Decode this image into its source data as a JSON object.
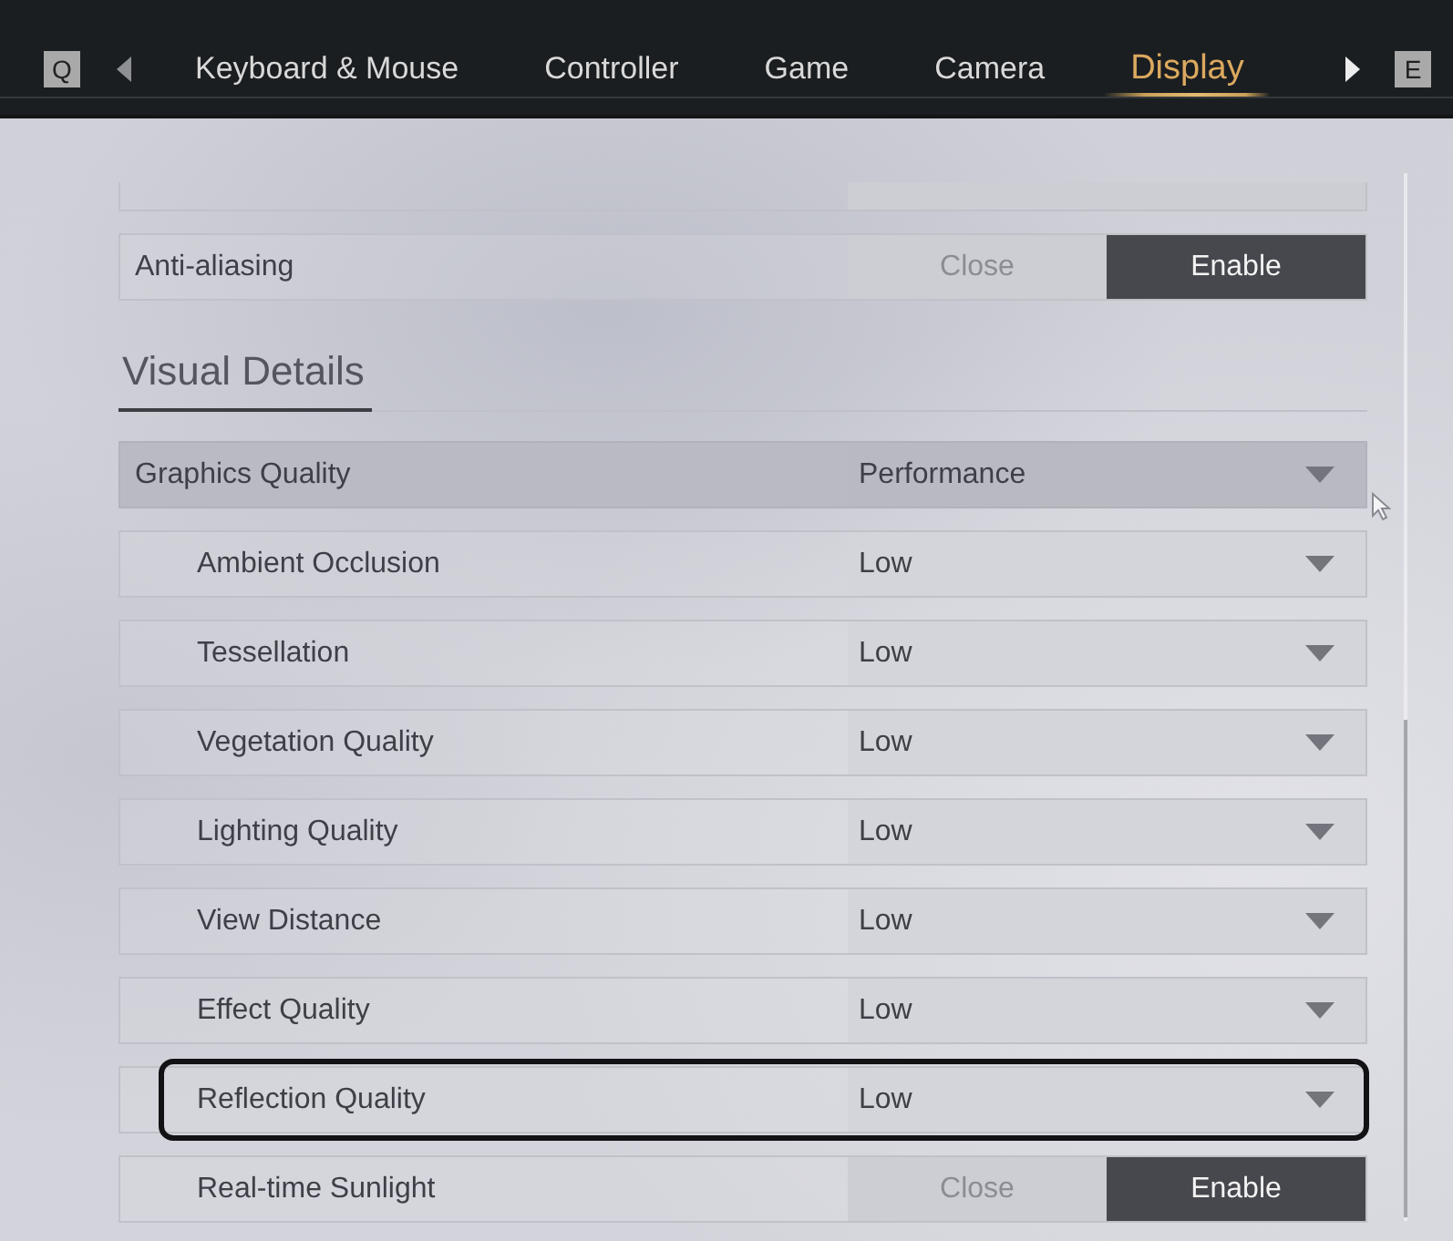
{
  "header": {
    "prev_key": "Q",
    "next_key": "E",
    "tabs": [
      {
        "label": "Keyboard & Mouse",
        "selected": false
      },
      {
        "label": "Controller",
        "selected": false
      },
      {
        "label": "Game",
        "selected": false
      },
      {
        "label": "Camera",
        "selected": false
      },
      {
        "label": "Display",
        "selected": true
      }
    ]
  },
  "settings": {
    "rows": [
      {
        "kind": "toggle",
        "label": "Anti-aliasing",
        "focused": false,
        "highlighted": false,
        "options": [
          {
            "label": "Close",
            "selected": false
          },
          {
            "label": "Enable",
            "selected": true
          }
        ]
      }
    ],
    "sections": [
      {
        "title": "Visual Details",
        "rows": [
          {
            "kind": "dropdown",
            "label": "Graphics Quality",
            "value": "Performance",
            "focused": true,
            "highlighted": false,
            "children": [
              {
                "kind": "dropdown",
                "label": "Ambient Occlusion",
                "value": "Low",
                "focused": false,
                "highlighted": false
              },
              {
                "kind": "dropdown",
                "label": "Tessellation",
                "value": "Low",
                "focused": false,
                "highlighted": false
              },
              {
                "kind": "dropdown",
                "label": "Vegetation Quality",
                "value": "Low",
                "focused": false,
                "highlighted": false
              },
              {
                "kind": "dropdown",
                "label": "Lighting Quality",
                "value": "Low",
                "focused": false,
                "highlighted": false
              },
              {
                "kind": "dropdown",
                "label": "View Distance",
                "value": "Low",
                "focused": false,
                "highlighted": false
              },
              {
                "kind": "dropdown",
                "label": "Effect Quality",
                "value": "Low",
                "focused": false,
                "highlighted": false
              },
              {
                "kind": "dropdown",
                "label": "Reflection Quality",
                "value": "Low",
                "focused": false,
                "highlighted": true
              },
              {
                "kind": "toggle",
                "label": "Real-time Sunlight",
                "focused": false,
                "highlighted": false,
                "options": [
                  {
                    "label": "Close",
                    "selected": false
                  },
                  {
                    "label": "Enable",
                    "selected": true
                  }
                ]
              }
            ]
          }
        ]
      }
    ]
  }
}
